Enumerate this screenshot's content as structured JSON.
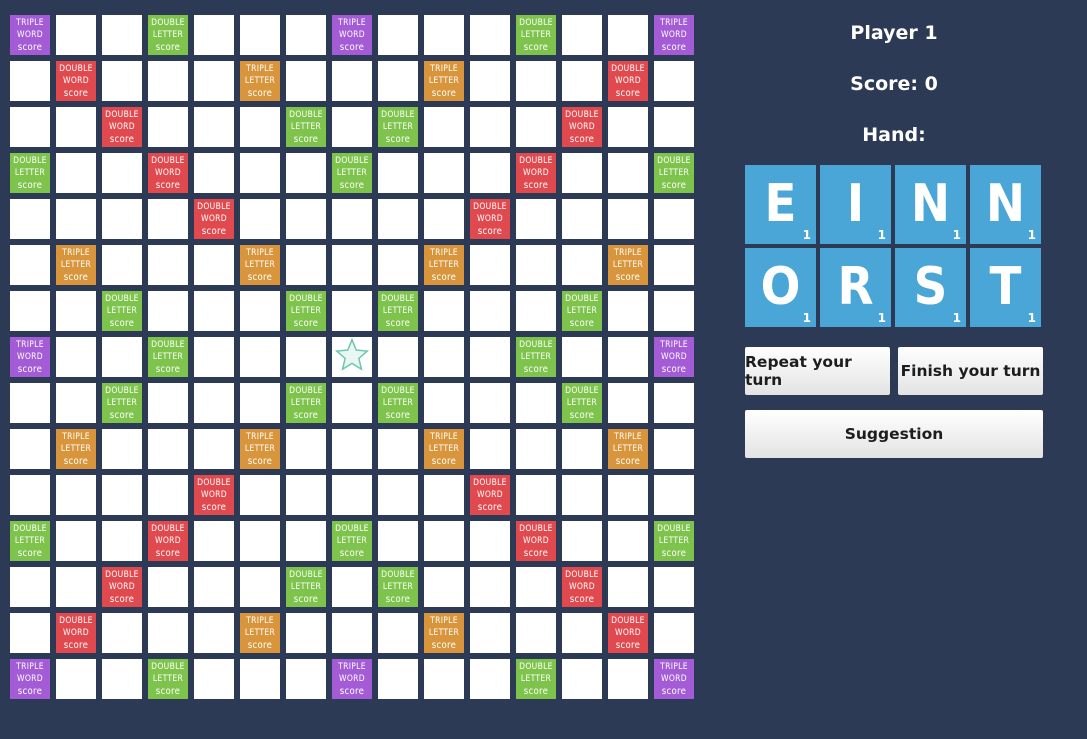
{
  "board": {
    "layout": [
      "TW..DL...TW...DL..TW",
      "x"
    ],
    "labels": {
      "TW": [
        "Triple",
        "Word",
        "score"
      ],
      "DW": [
        "Double",
        "Word",
        "score"
      ],
      "TL": [
        "Triple",
        "Letter",
        "score"
      ],
      "DL": [
        "Double",
        "Letter",
        "score"
      ]
    },
    "colors": {
      "TW": "#a35bd6",
      "DW": "#e04a4f",
      "TL": "#d9953c",
      "DL": "#7ec44c",
      "empty": "#ffffff",
      "star": "#6cc3b0"
    },
    "grid": [
      [
        "TW",
        "",
        "",
        "DL",
        "",
        "",
        "",
        "TW",
        "",
        "",
        "",
        "DL",
        "",
        "",
        "TW"
      ],
      [
        "",
        "DW",
        "",
        "",
        "",
        "TL",
        "",
        "",
        "",
        "TL",
        "",
        "",
        "",
        "DW",
        ""
      ],
      [
        "",
        "",
        "DW",
        "",
        "",
        "",
        "DL",
        "",
        "DL",
        "",
        "",
        "",
        "DW",
        "",
        ""
      ],
      [
        "DL",
        "",
        "",
        "DW",
        "",
        "",
        "",
        "DL",
        "",
        "",
        "",
        "DW",
        "",
        "",
        "DL"
      ],
      [
        "",
        "",
        "",
        "",
        "DW",
        "",
        "",
        "",
        "",
        "",
        "DW",
        "",
        "",
        "",
        ""
      ],
      [
        "",
        "TL",
        "",
        "",
        "",
        "TL",
        "",
        "",
        "",
        "TL",
        "",
        "",
        "",
        "TL",
        ""
      ],
      [
        "",
        "",
        "DL",
        "",
        "",
        "",
        "DL",
        "",
        "DL",
        "",
        "",
        "",
        "DL",
        "",
        ""
      ],
      [
        "TW",
        "",
        "",
        "DL",
        "",
        "",
        "",
        "ST",
        "",
        "",
        "",
        "DL",
        "",
        "",
        "TW"
      ],
      [
        "",
        "",
        "DL",
        "",
        "",
        "",
        "DL",
        "",
        "DL",
        "",
        "",
        "",
        "DL",
        "",
        ""
      ],
      [
        "",
        "TL",
        "",
        "",
        "",
        "TL",
        "",
        "",
        "",
        "TL",
        "",
        "",
        "",
        "TL",
        ""
      ],
      [
        "",
        "",
        "",
        "",
        "DW",
        "",
        "",
        "",
        "",
        "",
        "DW",
        "",
        "",
        "",
        ""
      ],
      [
        "DL",
        "",
        "",
        "DW",
        "",
        "",
        "",
        "DL",
        "",
        "",
        "",
        "DW",
        "",
        "",
        "DL"
      ],
      [
        "",
        "",
        "DW",
        "",
        "",
        "",
        "DL",
        "",
        "DL",
        "",
        "",
        "",
        "DW",
        "",
        ""
      ],
      [
        "",
        "DW",
        "",
        "",
        "",
        "TL",
        "",
        "",
        "",
        "TL",
        "",
        "",
        "",
        "DW",
        ""
      ],
      [
        "TW",
        "",
        "",
        "DL",
        "",
        "",
        "",
        "TW",
        "",
        "",
        "",
        "DL",
        "",
        "",
        "TW"
      ]
    ]
  },
  "player": {
    "name": "Player 1",
    "score_text": "Score: 0",
    "hand_label": "Hand:"
  },
  "hand": [
    {
      "letter": "E",
      "points": "1"
    },
    {
      "letter": "I",
      "points": "1"
    },
    {
      "letter": "N",
      "points": "1"
    },
    {
      "letter": "N",
      "points": "1"
    },
    {
      "letter": "O",
      "points": "1"
    },
    {
      "letter": "R",
      "points": "1"
    },
    {
      "letter": "S",
      "points": "1"
    },
    {
      "letter": "T",
      "points": "1"
    }
  ],
  "buttons": {
    "repeat": "Repeat your turn",
    "finish": "Finish your turn",
    "suggestion": "Suggestion"
  },
  "icons": {
    "center": "star-icon"
  }
}
